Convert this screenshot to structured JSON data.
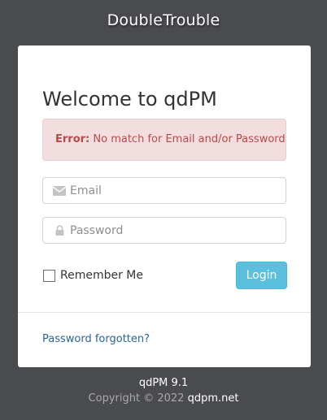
{
  "app": {
    "brand": "DoubleTrouble"
  },
  "login": {
    "title": "Welcome to qdPM",
    "error": {
      "label": "Error:",
      "message": "No match for Email and/or Password"
    },
    "email": {
      "placeholder": "Email",
      "value": "",
      "icon": "envelope-icon"
    },
    "password": {
      "placeholder": "Password",
      "value": "",
      "icon": "lock-icon"
    },
    "remember_label": "Remember Me",
    "remember_checked": false,
    "login_label": "Login",
    "forgot_label": "Password forgotten?"
  },
  "footer": {
    "version": "qdPM 9.1",
    "copyright": "Copyright © 2022",
    "link": "qdpm.net"
  },
  "colors": {
    "background": "#4a4b4f",
    "card": "#ffffff",
    "error_bg": "#f2dede",
    "error_text": "#b94a48",
    "button": "#5bc0de",
    "link": "#2a6496"
  }
}
